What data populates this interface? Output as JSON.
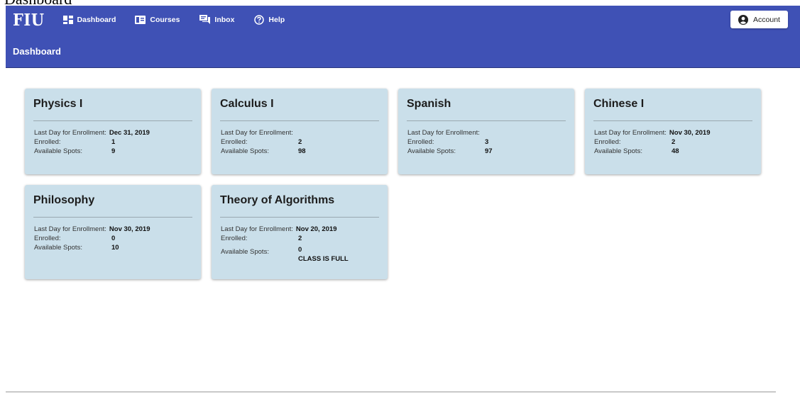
{
  "page": {
    "title": "Dashboard"
  },
  "header": {
    "logo": "FIU",
    "nav": [
      {
        "label": "Dashboard",
        "icon": "dashboard-icon"
      },
      {
        "label": "Courses",
        "icon": "courses-icon"
      },
      {
        "label": "Inbox",
        "icon": "inbox-icon"
      },
      {
        "label": "Help",
        "icon": "help-icon"
      }
    ],
    "account_label": "Account"
  },
  "subheader": {
    "title": "Dashboard"
  },
  "labels": {
    "last_day": "Last Day for Enrollment:",
    "enrolled": "Enrolled:",
    "spots": "Available Spots:"
  },
  "courses": [
    {
      "name": "Physics I",
      "last_day": "Dec 31, 2019",
      "enrolled": "1",
      "spots": "9",
      "note": ""
    },
    {
      "name": "Calculus I",
      "last_day": "",
      "enrolled": "2",
      "spots": "98",
      "note": ""
    },
    {
      "name": "Spanish",
      "last_day": "",
      "enrolled": "3",
      "spots": "97",
      "note": ""
    },
    {
      "name": "Chinese I",
      "last_day": "Nov 30, 2019",
      "enrolled": "2",
      "spots": "48",
      "note": ""
    },
    {
      "name": "Philosophy",
      "last_day": "Nov 30, 2019",
      "enrolled": "0",
      "spots": "10",
      "note": ""
    },
    {
      "name": "Theory of Algorithms",
      "last_day": "Nov 20, 2019",
      "enrolled": "2",
      "spots": "0",
      "note": "CLASS IS FULL"
    }
  ],
  "colors": {
    "primary": "#3f51b5",
    "card": "#cadfea"
  }
}
